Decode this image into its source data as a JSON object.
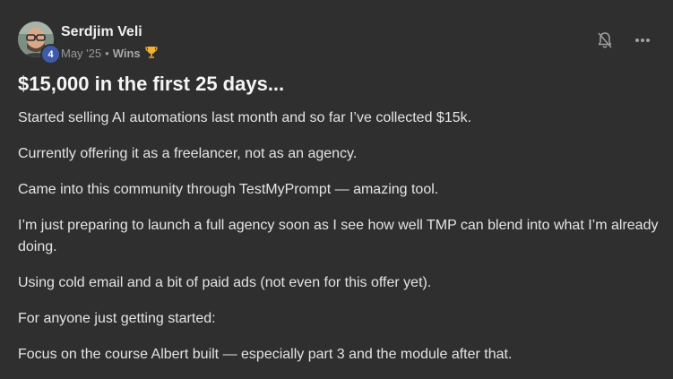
{
  "post": {
    "author": {
      "name": "Serdjim Veli",
      "level": "4"
    },
    "meta": {
      "date": "May '25",
      "separator": "•",
      "category": "Wins",
      "category_icon": "trophy-icon"
    },
    "actions": {
      "notify_icon": "bell-off-icon",
      "more_icon": "more-horizontal-icon"
    },
    "title": "$15,000 in the first 25 days...",
    "paragraphs": [
      "Started selling AI automations last month and so far I’ve collected $15k.",
      "Currently offering it as a freelancer, not as an agency.",
      "Came into this community through TestMyPrompt — amazing tool.",
      "I’m just preparing to launch a full agency soon as I see how well TMP can blend into what I’m already doing.",
      "Using cold email and a bit of paid ads (not even for this offer yet).",
      "For anyone just getting started:",
      "Focus on the course Albert built — especially part 3 and the module after that."
    ]
  },
  "colors": {
    "background": "#2f2f2f",
    "level_badge": "#3d5ba9",
    "trophy": "#f2b233"
  }
}
